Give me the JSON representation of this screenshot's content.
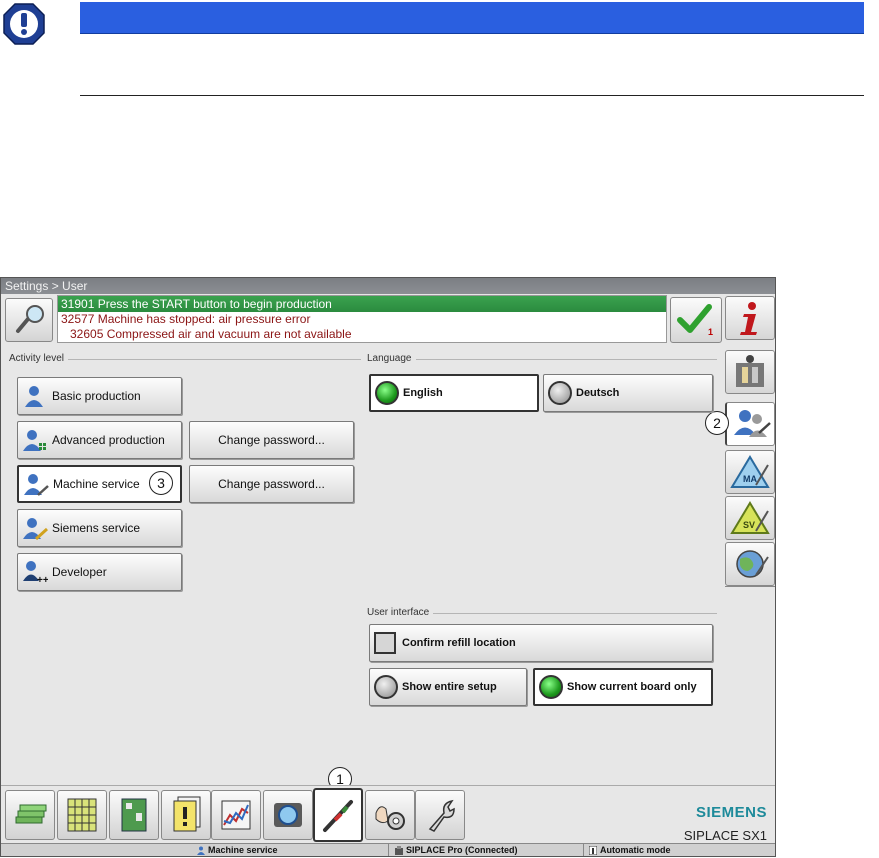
{
  "screen": {
    "breadcrumb": "Settings > User"
  },
  "messages": {
    "top": "31901 Press the START button to begin production",
    "line1": "32577 Machine has stopped: air pressure error",
    "line2": "32605 Compressed air and vacuum are not available",
    "ack_count": "1"
  },
  "activity": {
    "label": "Activity level",
    "levels": [
      {
        "label": "Basic production"
      },
      {
        "label": "Advanced production"
      },
      {
        "label": "Machine service"
      },
      {
        "label": "Siemens service"
      },
      {
        "label": "Developer"
      }
    ],
    "selected": "Machine service",
    "change_password_1": "Change password...",
    "change_password_2": "Change password..."
  },
  "language": {
    "label": "Language",
    "options": [
      "English",
      "Deutsch"
    ],
    "selected": "English"
  },
  "user_interface": {
    "label": "User interface",
    "confirm_refill": "Confirm refill location",
    "show_entire": "Show entire setup",
    "show_current": "Show current board only",
    "confirm_refill_checked": false,
    "selected_view": "Show current board only"
  },
  "branding": {
    "company": "SIEMENS",
    "product": "SIPLACE SX1"
  },
  "status_bar": {
    "user": "Machine service",
    "connection": "SIPLACE Pro (Connected)",
    "mode": "Automatic mode"
  },
  "callouts": {
    "c1": "1",
    "c2": "2",
    "c3": "3"
  },
  "colors": {
    "notice_bar": "#2a5fe0",
    "message_green": "#2b8b3f",
    "error_text": "#8b1515",
    "brand": "#1d8a9a"
  },
  "icons": {
    "notice": "exclamation-icon",
    "bottom_bar": [
      "production-icon",
      "setup-grid-icon",
      "board-icon",
      "warning-list-icon",
      "statistics-icon",
      "camera-icon",
      "tools-icon",
      "machine-settings-icon",
      "wrench-icon"
    ],
    "right_bar": [
      "info-icon",
      "station-icon",
      "user-icon",
      "machine-service-icon",
      "service-icon",
      "globe-icon"
    ]
  }
}
